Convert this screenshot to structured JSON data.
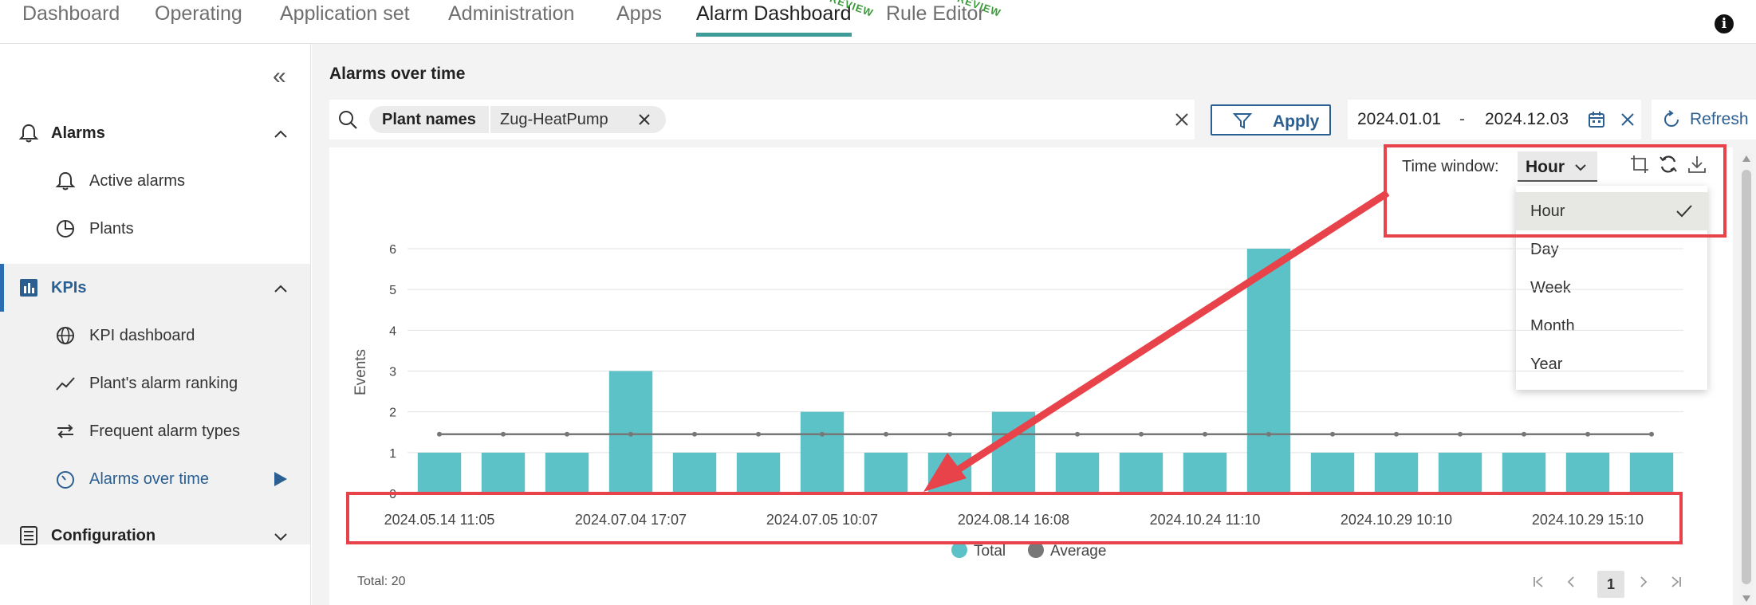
{
  "topnav": {
    "tabs": [
      "Dashboard",
      "Operating",
      "Application set",
      "Administration",
      "Apps",
      "Alarm Dashboard",
      "Rule Editor"
    ],
    "active_tab": "Alarm Dashboard",
    "preview_badge": "PREVIEW"
  },
  "sidebar": {
    "sections": [
      {
        "label": "Alarms",
        "items": [
          "Active alarms",
          "Plants"
        ]
      },
      {
        "label": "KPIs",
        "items": [
          "KPI dashboard",
          "Plant's alarm ranking",
          "Frequent alarm types",
          "Alarms over time"
        ]
      },
      {
        "label": "Configuration",
        "items": []
      }
    ],
    "current_item": "Alarms over time"
  },
  "main": {
    "title": "Alarms over time",
    "filter": {
      "key": "Plant names",
      "value": "Zug-HeatPump"
    },
    "apply_label": "Apply",
    "date_start": "2024.01.01",
    "date_separator": "-",
    "date_end": "2024.12.03",
    "refresh_label": "Refresh",
    "time_window": {
      "label": "Time window:",
      "selected": "Hour",
      "options": [
        "Hour",
        "Day",
        "Week",
        "Month",
        "Year"
      ]
    },
    "total_label": "Total: 20",
    "pagination": {
      "current_page": "1"
    }
  },
  "chart_data": {
    "type": "bar",
    "title": "",
    "xlabel": "",
    "ylabel": "Events",
    "ylim": [
      0,
      6
    ],
    "yticks": [
      0,
      1,
      2,
      3,
      4,
      5,
      6
    ],
    "x_tick_labels": [
      "2024.05.14 11:05",
      "2024.07.04 17:07",
      "2024.07.05 10:07",
      "2024.08.14 16:08",
      "2024.10.24 11:10",
      "2024.10.29 10:10",
      "2024.10.29 15:10"
    ],
    "categories_count": 20,
    "series": [
      {
        "name": "Total",
        "type": "bar",
        "color": "#5cc2c7",
        "values": [
          1,
          1,
          1,
          3,
          1,
          1,
          2,
          1,
          1,
          2,
          1,
          1,
          1,
          6,
          1,
          1,
          1,
          1,
          1,
          1
        ]
      },
      {
        "name": "Average",
        "type": "line",
        "color": "#777777",
        "values": [
          1.45,
          1.45,
          1.45,
          1.45,
          1.45,
          1.45,
          1.45,
          1.45,
          1.45,
          1.45,
          1.45,
          1.45,
          1.45,
          1.45,
          1.45,
          1.45,
          1.45,
          1.45,
          1.45,
          1.45
        ]
      }
    ],
    "legend": [
      "Total",
      "Average"
    ],
    "legend_placement": "bottom",
    "grid": true
  },
  "colors": {
    "accent": "#2b5f92",
    "tab_underline": "#3f9c98",
    "annotation": "#e8424a"
  }
}
